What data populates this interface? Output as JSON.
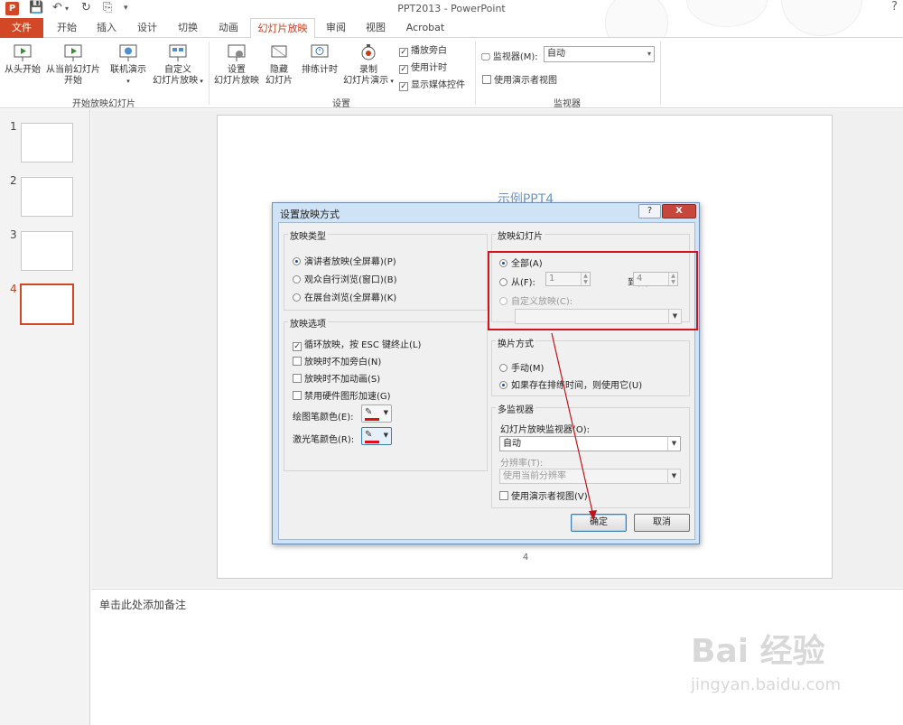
{
  "window": {
    "title": "PPT2013 - PowerPoint",
    "app_icon": "P"
  },
  "ribbon_tabs": [
    {
      "label": "文件"
    },
    {
      "label": "开始"
    },
    {
      "label": "插入"
    },
    {
      "label": "设计"
    },
    {
      "label": "切换"
    },
    {
      "label": "动画"
    },
    {
      "label": "幻灯片放映"
    },
    {
      "label": "审阅"
    },
    {
      "label": "视图"
    },
    {
      "label": "Acrobat"
    }
  ],
  "ribbon": {
    "start_group": {
      "label": "开始放映幻灯片",
      "from_start": "从头开始",
      "from_current_1": "从当前幻灯片",
      "from_current_2": "开始",
      "online_present": "联机演示",
      "custom_show_1": "自定义",
      "custom_show_2": "幻灯片放映"
    },
    "setup_group": {
      "label": "设置",
      "setup_show_1": "设置",
      "setup_show_2": "幻灯片放映",
      "hide_slide_1": "隐藏",
      "hide_slide_2": "幻灯片",
      "rehearse": "排练计时",
      "record_1": "录制",
      "record_2": "幻灯片演示",
      "play_narrations": "播放旁白",
      "use_timings": "使用计时",
      "show_media_controls": "显示媒体控件"
    },
    "monitor_group": {
      "label": "监视器",
      "monitor_label": "监视器(M):",
      "monitor_value": "自动",
      "presenter_view": "使用演示者视图"
    }
  },
  "thumbnails": [
    {
      "num": "1"
    },
    {
      "num": "2"
    },
    {
      "num": "3"
    },
    {
      "num": "4"
    }
  ],
  "slide": {
    "title": "示例PPT4",
    "number": "4"
  },
  "notes": {
    "placeholder": "单击此处添加备注"
  },
  "watermark": {
    "text": "Bai 经验",
    "url": "jingyan.baidu.com"
  },
  "dialog": {
    "title": "设置放映方式",
    "help": "?",
    "close": "X",
    "show_type": {
      "label": "放映类型",
      "presenter": "演讲者放映(全屏幕)(P)",
      "individual": "观众自行浏览(窗口)(B)",
      "kiosk": "在展台浏览(全屏幕)(K)"
    },
    "show_options": {
      "label": "放映选项",
      "loop": "循环放映，按 ESC 键终止(L)",
      "no_narration": "放映时不加旁白(N)",
      "no_animation": "放映时不加动画(S)",
      "disable_hw": "禁用硬件图形加速(G)",
      "pen_color": "绘图笔颜色(E):",
      "laser_color": "激光笔颜色(R):"
    },
    "show_slides": {
      "label": "放映幻灯片",
      "all": "全部(A)",
      "from": "从(F):",
      "from_value": "1",
      "to": "到(T):",
      "to_value": "4",
      "custom": "自定义放映(C):"
    },
    "advance": {
      "label": "换片方式",
      "manual": "手动(M)",
      "use_timings": "如果存在排练时间，则使用它(U)"
    },
    "monitors": {
      "label": "多监视器",
      "monitor_label": "幻灯片放映监视器(O):",
      "monitor_value": "自动",
      "resolution_label": "分辨率(T):",
      "resolution_value": "使用当前分辨率",
      "presenter_view": "使用演示者视图(V)"
    },
    "ok": "确定",
    "cancel": "取消"
  },
  "colors": {
    "accent": "#d24726",
    "highlight": "#d0141b",
    "pen_red": "#e0101a"
  }
}
